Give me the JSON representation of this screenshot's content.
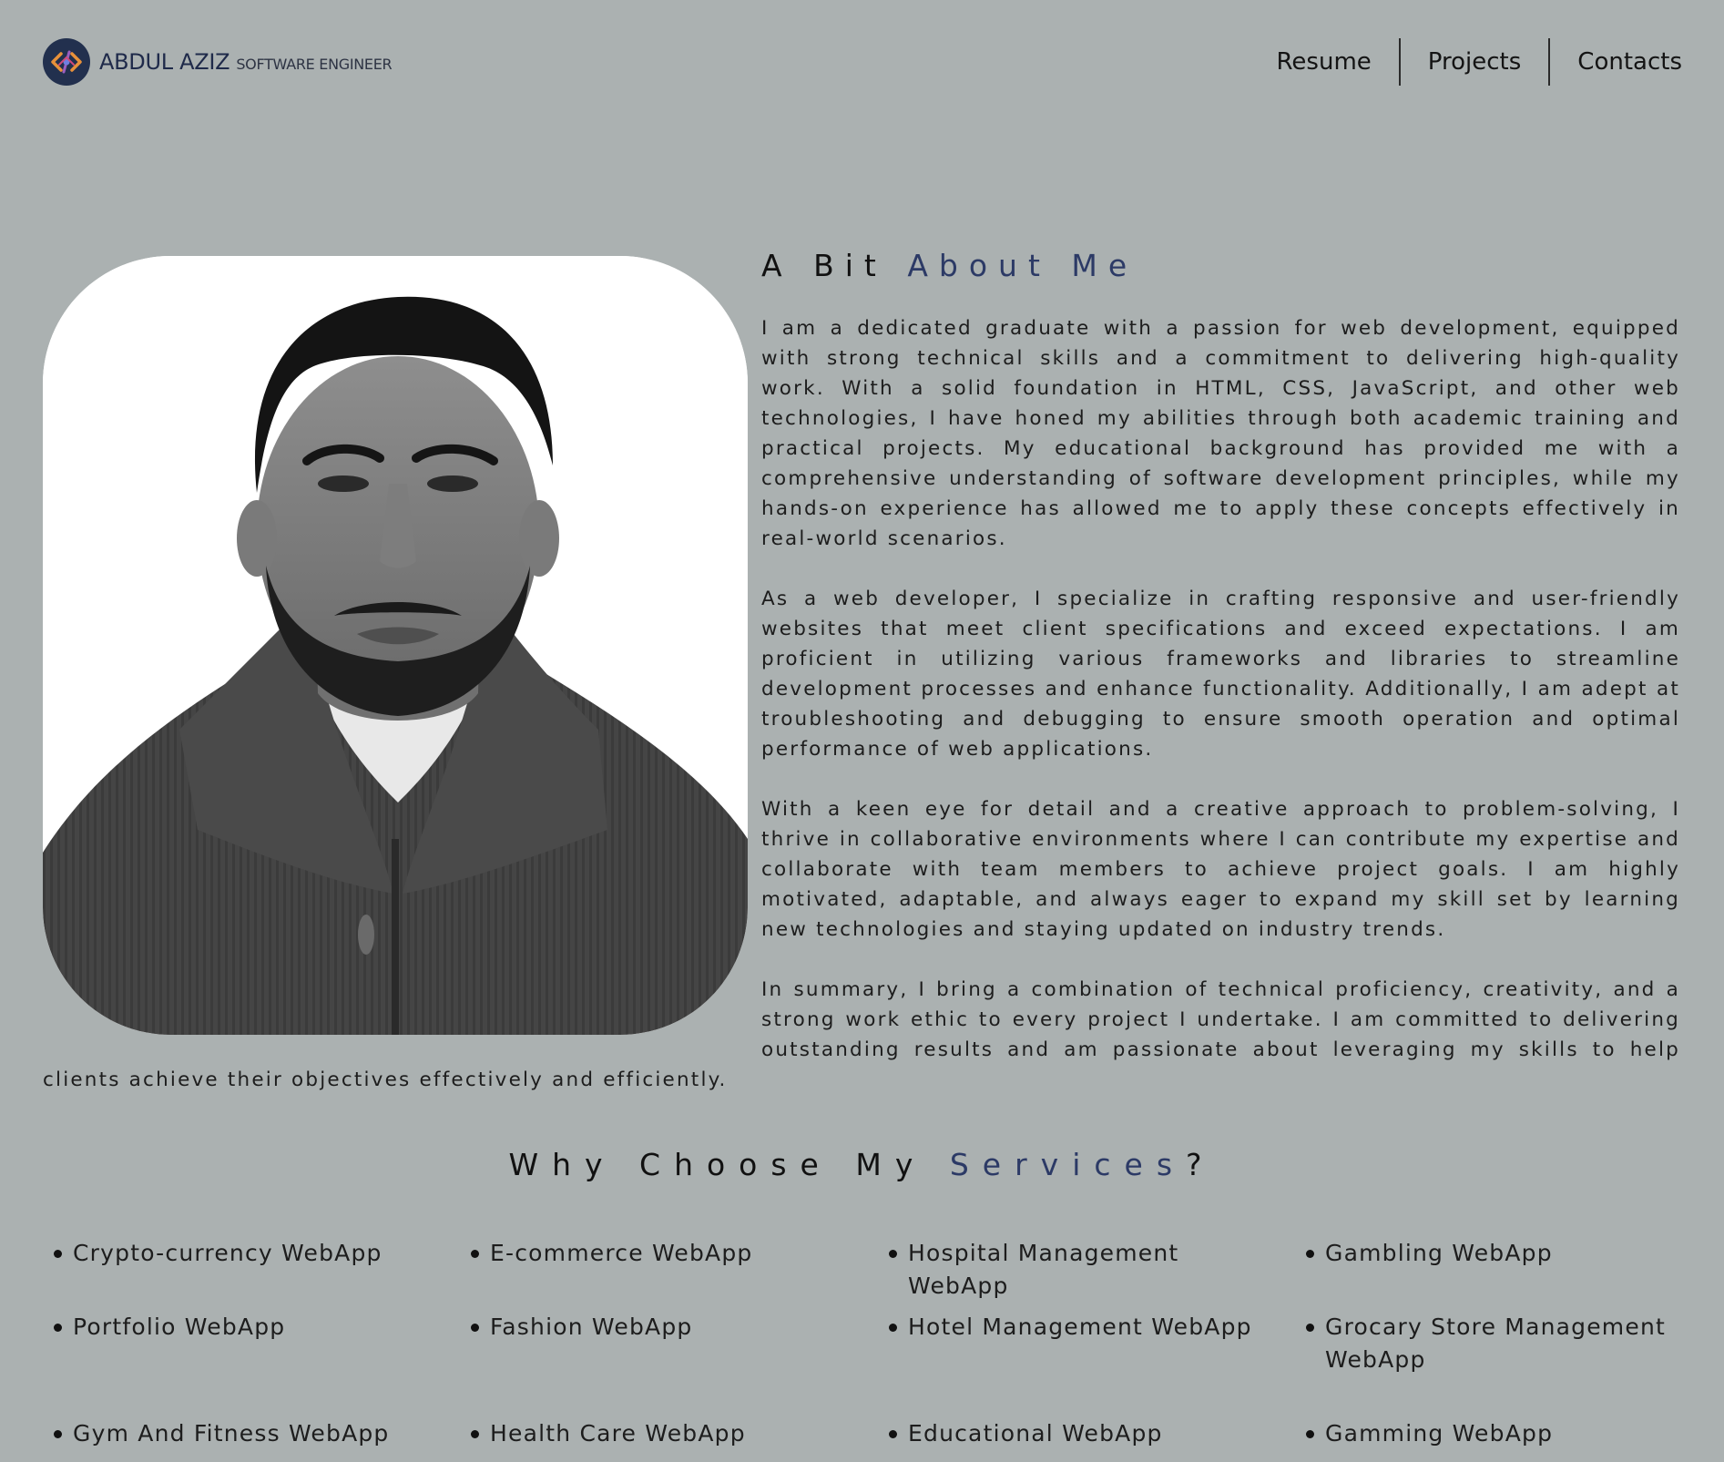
{
  "header": {
    "brand_name": "ABDUL AZIZ",
    "brand_role": "SOFTWARE ENGINEER",
    "logo_icon": "code-brackets-icon",
    "nav": [
      "Resume",
      "Projects",
      "Contacts"
    ]
  },
  "about": {
    "title_plain": "A Bit ",
    "title_accent": "About Me",
    "paragraphs": [
      "I am a dedicated graduate with a passion for web development, equipped with strong technical skills and a commitment to delivering high-quality work. With a solid foundation in HTML, CSS, JavaScript, and other web technologies, I have honed my abilities through both academic training and practical projects. My educational background has provided me with a comprehensive understanding of software development principles, while my hands-on experience has allowed me to apply these concepts effectively in real-world scenarios.",
      "As a web developer, I specialize in crafting responsive and user-friendly websites that meet client specifications and exceed expectations. I am proficient in utilizing various frameworks and libraries to streamline development processes and enhance functionality. Additionally, I am adept at troubleshooting and debugging to ensure smooth operation and optimal performance of web applications.",
      "With a keen eye for detail and a creative approach to problem-solving, I thrive in collaborative environments where I can contribute my expertise and collaborate with team members to achieve project goals. I am highly motivated, adaptable, and always eager to expand my skill set by learning new technologies and staying updated on industry trends.",
      "In summary, I bring a combination of technical proficiency, creativity, and a strong work ethic to every project I undertake. I am committed to delivering outstanding results and am passionate about leveraging my skills to help clients achieve their objectives effectively and efficiently."
    ]
  },
  "services": {
    "title_plain": "Why Choose My ",
    "title_accent": "Services",
    "title_end": "?",
    "items": [
      "Crypto-currency WebApp",
      "E-commerce WebApp",
      "Hospital Management WebApp",
      "Gambling WebApp",
      "Portfolio WebApp",
      "Fashion WebApp",
      "Hotel Management WebApp",
      "Grocary Store Management WebApp",
      "Gym And Fitness WebApp",
      "Health Care WebApp",
      "Educational WebApp",
      "Gamming WebApp"
    ]
  },
  "colors": {
    "background": "#abb1b1",
    "accent": "#2c3a66",
    "logo_bg": "#22304e"
  }
}
